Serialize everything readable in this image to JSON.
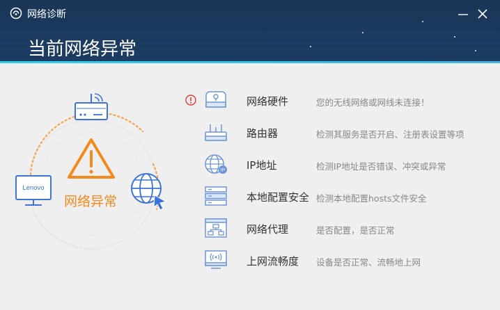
{
  "window": {
    "app_title": "网络诊断",
    "status_heading": "当前网络异常",
    "minimize_icon": "minimize-icon",
    "close_icon": "close-icon"
  },
  "diagram": {
    "center_label": "网络异常",
    "computer_brand": "Lenovo",
    "colors": {
      "warning": "#f38a1d",
      "device": "#3c73d9",
      "error": "#e03a2f"
    }
  },
  "checks": [
    {
      "name": "网络硬件",
      "desc": "您的无线网络或网线未连接！",
      "icon": "network-card-icon",
      "status": "error"
    },
    {
      "name": "路由器",
      "desc": "检测其服务是否开启、注册表设置等项",
      "icon": "router-icon",
      "status": ""
    },
    {
      "name": "IP地址",
      "desc": "检测IP地址是否错误、冲突或异常",
      "icon": "ip-globe-icon",
      "status": ""
    },
    {
      "name": "本地配置安全",
      "desc": "检测本地配置hosts文件安全",
      "icon": "server-icon",
      "status": ""
    },
    {
      "name": "网络代理",
      "desc": "是否配置，是否正常",
      "icon": "proxy-icon",
      "status": ""
    },
    {
      "name": "上网流畅度",
      "desc": "设备是否正常、流畅地上网",
      "icon": "monitor-wifi-icon",
      "status": ""
    }
  ]
}
